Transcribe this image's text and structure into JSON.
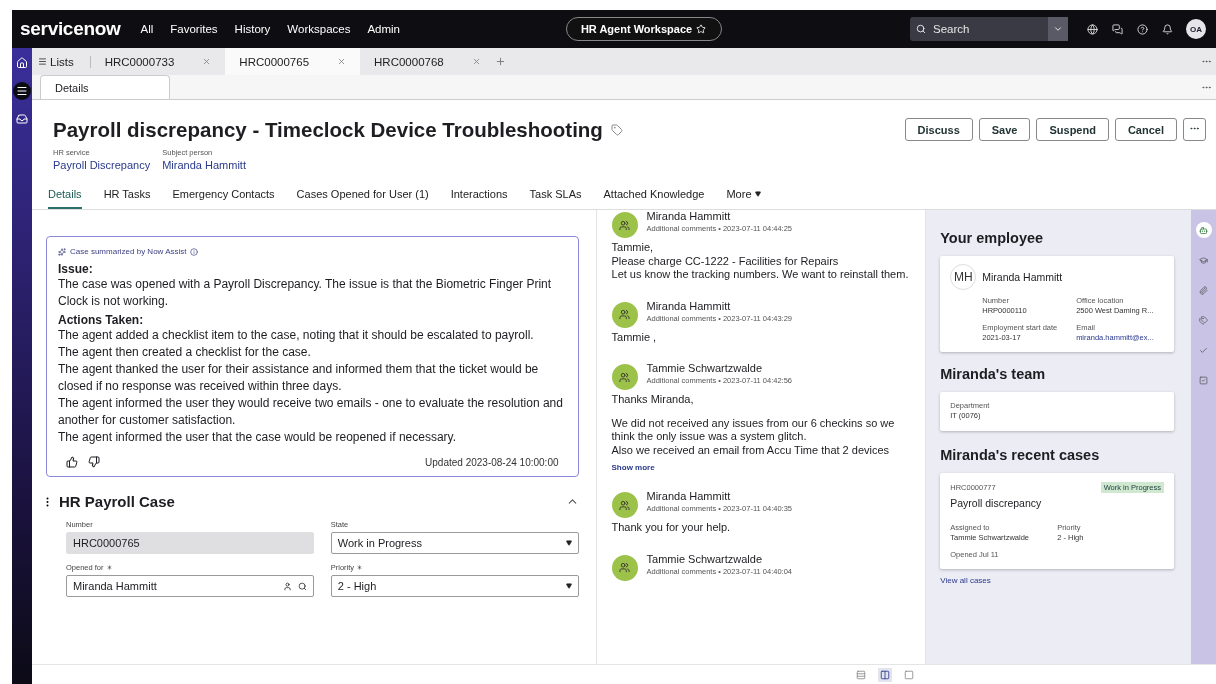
{
  "nav": {
    "logo": "servicenow",
    "menu": [
      "All",
      "Favorites",
      "History",
      "Workspaces",
      "Admin"
    ],
    "workspace": "HR Agent Workspace",
    "search": {
      "placeholder": "Search"
    },
    "avatar": "OA"
  },
  "rail": [
    {
      "kind": "home",
      "selected": false
    },
    {
      "kind": "list",
      "selected": true
    },
    {
      "kind": "inbox",
      "selected": false
    }
  ],
  "record_tabs": {
    "lists_label": "Lists",
    "tabs": [
      {
        "label": "HRC0000733",
        "selected": false
      },
      {
        "label": "HRC0000765",
        "selected": true
      },
      {
        "label": "HRC0000768",
        "selected": false
      }
    ]
  },
  "sub_tab": "Details",
  "header": {
    "title": "Payroll discrepancy - Timeclock Device Troubleshooting",
    "buttons": [
      "Discuss",
      "Save",
      "Suspend",
      "Cancel"
    ],
    "meta": [
      {
        "label": "HR service",
        "value": "Payroll Discrepancy"
      },
      {
        "label": "Subject person",
        "value": "Miranda Hammitt"
      }
    ]
  },
  "tabs": [
    {
      "label": "Details",
      "selected": true
    },
    {
      "label": "HR Tasks",
      "selected": false
    },
    {
      "label": "Emergency Contacts",
      "selected": false
    },
    {
      "label": "Cases Opened for User (1)",
      "selected": false
    },
    {
      "label": "Interactions",
      "selected": false
    },
    {
      "label": "Task SLAs",
      "selected": false
    },
    {
      "label": "Attached Knowledge",
      "selected": false
    },
    {
      "label": "More",
      "selected": false
    }
  ],
  "summary": {
    "source": "Case summarized by Now Assist",
    "blocks": [
      {
        "kind": "heading",
        "text": "Issue:"
      },
      {
        "kind": "text",
        "text": "The case was opened with a Payroll Discrepancy. The issue is that the Biometric Finger Print Clock is not working."
      },
      {
        "kind": "heading",
        "text": "Actions Taken:"
      },
      {
        "kind": "text",
        "text": "The agent added a checklist item to the case, noting that it should be escalated to payroll."
      },
      {
        "kind": "text",
        "text": "The agent then created a checklist for the case."
      },
      {
        "kind": "text",
        "text": "The agent thanked the user for their assistance and informed them that the ticket would be closed if no response was received within three days."
      },
      {
        "kind": "text",
        "text": "The agent informed the user they would receive two emails - one to evaluate the resolution and another for customer satisfaction."
      },
      {
        "kind": "text",
        "text": "The agent informed the user that the case would be reopened if necessary."
      }
    ],
    "updated": "Updated 2023-08-24 10:00:00"
  },
  "form": {
    "title": "HR Payroll Case",
    "fields": [
      {
        "kind": "readonly",
        "label": "Number",
        "value": "HRC0000765",
        "required": false
      },
      {
        "kind": "select",
        "label": "State",
        "value": "Work in Progress",
        "required": false
      },
      {
        "kind": "reference",
        "label": "Opened for",
        "value": "Miranda Hammitt",
        "required": true
      },
      {
        "kind": "select",
        "label": "Priority",
        "value": "2 - High",
        "required": true
      }
    ]
  },
  "activity": [
    {
      "author": "Miranda Hammitt",
      "meta": "Additional comments • 2023-07-11 04:44:25",
      "paragraphs": [
        [
          "Tammie,",
          "Please charge CC-1222 - Facilities for Repairs",
          "Let us know the tracking numbers. We want to reinstall them."
        ]
      ]
    },
    {
      "author": "Miranda Hammitt",
      "meta": "Additional comments • 2023-07-11 04:43:29",
      "paragraphs": [
        [
          "Tammie ,"
        ]
      ]
    },
    {
      "author": "Tammie Schwartzwalde",
      "meta": "Additional comments • 2023-07-11 04:42:56",
      "paragraphs": [
        [
          "Thanks Miranda,"
        ],
        [
          "We did not received any issues from our 6 checkins so we think the only issue was a system glitch.",
          "Also we received an email from Accu Time that 2 devices"
        ]
      ],
      "more": "Show more"
    },
    {
      "author": "Miranda Hammitt",
      "meta": "Additional comments • 2023-07-11 04:40:35",
      "paragraphs": [
        [
          "Thank you for your help."
        ]
      ]
    },
    {
      "author": "Tammie Schwartzwalde",
      "meta": "Additional comments • 2023-07-11 04:40:04"
    }
  ],
  "employee": {
    "heading": "Your employee",
    "initials": "MH",
    "name": "Miranda Hammitt",
    "fields": [
      {
        "label": "Number",
        "value": "HRP0000110",
        "kind": "text"
      },
      {
        "label": "Office location",
        "value": "2500 West Daming R...",
        "kind": "text"
      },
      {
        "label": "Employment start date",
        "value": "2021-03-17",
        "kind": "text"
      },
      {
        "label": "Email",
        "value": "miranda.hammitt@ex...",
        "kind": "link"
      }
    ]
  },
  "team": {
    "heading": "Miranda's team",
    "label": "Department",
    "value": "IT (0076)"
  },
  "recent": {
    "heading": "Miranda's recent cases",
    "number": "HRC0000777",
    "status": "Work in Progress",
    "title": "Payroll discrepancy",
    "fields": [
      {
        "label": "Assigned to",
        "value": "Tammie Schwartzwalde"
      },
      {
        "label": "Priority",
        "value": "2 - High"
      }
    ],
    "opened": "Opened Jul 11",
    "link": "View all cases"
  },
  "side_rail": [
    {
      "kind": "ai",
      "selected": true
    },
    {
      "kind": "learn",
      "selected": false
    },
    {
      "kind": "attach",
      "selected": false
    },
    {
      "kind": "tags",
      "selected": false
    },
    {
      "kind": "check",
      "selected": false
    },
    {
      "kind": "task",
      "selected": false
    }
  ],
  "views": [
    {
      "kind": "rows",
      "selected": false
    },
    {
      "kind": "split",
      "selected": true
    },
    {
      "kind": "single",
      "selected": false
    }
  ]
}
